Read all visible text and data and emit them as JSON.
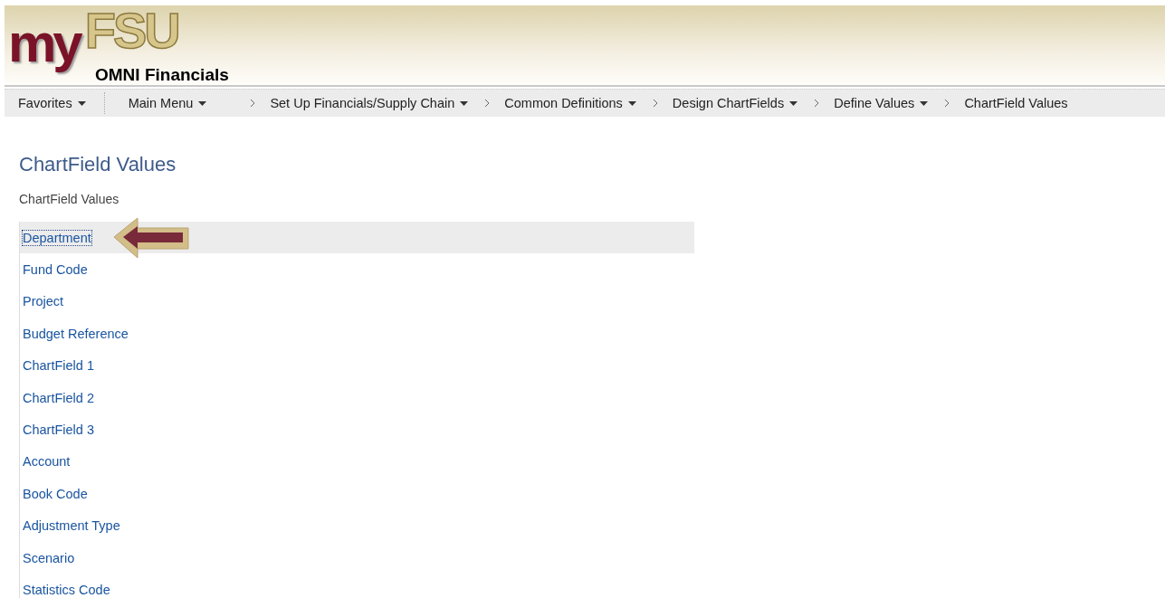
{
  "header": {
    "logo_my": "my",
    "logo_fsu": "FSU",
    "app_name": "OMNI Financials"
  },
  "nav": [
    {
      "label": "Favorites",
      "dropdown": true
    },
    {
      "label": "Main Menu",
      "dropdown": true
    },
    {
      "label": "Set Up Financials/Supply Chain",
      "dropdown": true
    },
    {
      "label": "Common Definitions",
      "dropdown": true
    },
    {
      "label": "Design ChartFields",
      "dropdown": true
    },
    {
      "label": "Define Values",
      "dropdown": true
    },
    {
      "label": "ChartField Values",
      "dropdown": false
    }
  ],
  "page": {
    "title": "ChartField Values",
    "subtitle": "ChartField Values"
  },
  "links": [
    {
      "label": "Department",
      "selected": true
    },
    {
      "label": "Fund Code",
      "selected": false
    },
    {
      "label": "Project",
      "selected": false
    },
    {
      "label": "Budget Reference",
      "selected": false
    },
    {
      "label": "ChartField 1",
      "selected": false
    },
    {
      "label": "ChartField 2",
      "selected": false
    },
    {
      "label": "ChartField 3",
      "selected": false
    },
    {
      "label": "Account",
      "selected": false
    },
    {
      "label": "Book Code",
      "selected": false
    },
    {
      "label": "Adjustment Type",
      "selected": false
    },
    {
      "label": "Scenario",
      "selected": false
    },
    {
      "label": "Statistics Code",
      "selected": false
    }
  ]
}
